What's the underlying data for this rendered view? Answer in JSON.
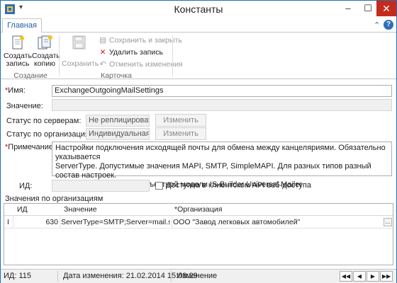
{
  "window": {
    "title": "Константы",
    "minimize": "–",
    "maximize": "☐",
    "close": "✕"
  },
  "ribbon": {
    "tab_main": "Главная",
    "collapse": "⌃",
    "help": "?",
    "btn_create_record": [
      "Создать",
      "запись"
    ],
    "btn_create_copy": [
      "Создать",
      "копию"
    ],
    "group_create": "Создание",
    "btn_save": "Сохранить",
    "btn_save_close": "Сохранить и закрыть",
    "btn_delete": "Удалить запись",
    "btn_cancel_changes": "Отменить изменения",
    "group_card": "Карточка"
  },
  "form": {
    "name_label": "*Имя:",
    "name_value": "ExchangeOutgoingMailSettings",
    "value_label": "Значение:",
    "value_value": "",
    "server_status_label": "Статус по серверам:",
    "server_status_value": "Не реплицировать",
    "server_change": "Изменить",
    "org_status_label": "Статус по организациям:",
    "org_status_value": "Индивидуальная",
    "org_change": "Изменить",
    "note_label": "*Примечание:",
    "note_lines": [
      "Настройки подключения исходящей почты для обмена между канцеляриями. Обязательно указывается",
      "ServerType. Допустимые значения MAPI, SMTP, SimpleMAPI. Для разных типов разный состав настроек.",
      "Подробнее в описании объектной модели IS-Builder Universal Mailer"
    ],
    "id_label": "ИД:",
    "id_value": "",
    "web_api_label": "Доступна в клиентском API веб-доступа",
    "web_api_checked": false
  },
  "grid": {
    "section_label": "Значения по организациям",
    "columns": [
      "ИД",
      "Значение",
      "*Организация"
    ],
    "rows": [
      {
        "marker": "I",
        "id": "630",
        "value": "ServerType=SMTP;Server=mail.serve...",
        "org": "ООО \"Завод легковых автомобилей\""
      }
    ],
    "ellipsis": "..."
  },
  "status": {
    "id": "ИД: 115",
    "modified": "Дата изменения: 21.02.2014 15:08:29",
    "mode": "Изменение"
  }
}
